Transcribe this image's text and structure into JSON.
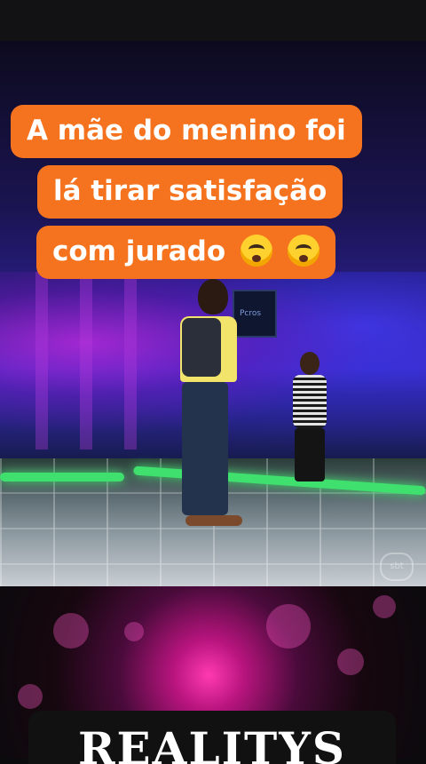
{
  "caption": {
    "line1": "A mãe do menino foi",
    "line2": "lá tirar satisfação",
    "line3": "com jurado",
    "emojis": [
      "anguished-face-icon",
      "anguished-face-icon"
    ]
  },
  "video": {
    "screen_text": "Pcros",
    "watermark": "sbt"
  },
  "banner": {
    "text": "REALITYS"
  },
  "colors": {
    "caption_bg": "#f5731f",
    "caption_text": "#ffffff",
    "stage_green": "#3fe06d",
    "banner_bg": "#111112"
  }
}
